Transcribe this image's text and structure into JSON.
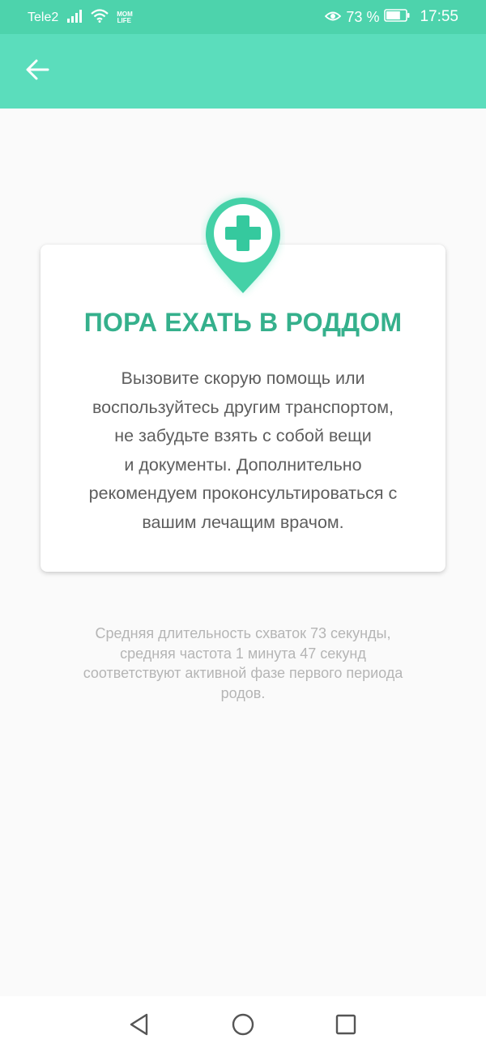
{
  "status_bar": {
    "carrier": "Tele2",
    "badge_line1": "MOM",
    "badge_line2": "LIFE",
    "battery_percent": "73 %",
    "time": "17:55",
    "battery_level": 0.73
  },
  "app_bar": {
    "back_icon": "arrow-left-icon"
  },
  "card": {
    "icon": "medical-location-pin-icon",
    "title": "ПОРА ЕХАТЬ В РОДДОМ",
    "text_lines": [
      "Вызовите скорую помощь или",
      "воспользуйтесь другим транспортом,",
      "не забудьте взять с собой вещи",
      "и документы. Дополнительно",
      "рекомендуем проконсультироваться с",
      "вашим лечащим врачом."
    ]
  },
  "info": {
    "lines": [
      "Средняя длительность схваток 73 секунды,",
      "средняя частота 1 минута 47 секунд",
      "соответствуют активной фазе первого периода",
      "родов."
    ]
  },
  "nav_bar": {
    "back": "triangle-back-icon",
    "home": "circle-home-icon",
    "recents": "square-recents-icon"
  },
  "colors": {
    "status_bar": "#4dd3ac",
    "app_bar": "#5bddbc",
    "accent": "#35b08c",
    "pin": "#4dd3ac"
  }
}
